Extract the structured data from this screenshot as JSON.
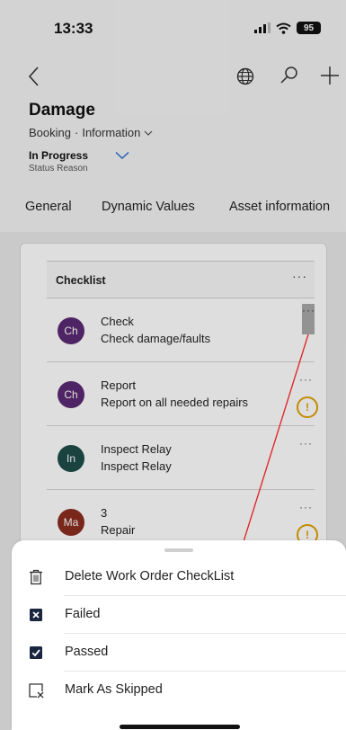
{
  "status_bar": {
    "time": "13:33",
    "battery": "95"
  },
  "record": {
    "title": "Damage",
    "entity": "Booking",
    "separator": "·",
    "form": "Information",
    "status_value": "In Progress",
    "status_label": "Status Reason"
  },
  "tabs": [
    {
      "label": "General"
    },
    {
      "label": "Dynamic Values"
    },
    {
      "label": "Asset information"
    }
  ],
  "checklist": {
    "title": "Checklist",
    "more": "···",
    "items": [
      {
        "initials": "Ch",
        "title": "Check",
        "subtitle": "Check damage/faults",
        "avatar_color": "#5b2a73",
        "warning": false
      },
      {
        "initials": "Ch",
        "title": "Report",
        "subtitle": "Report on all needed repairs",
        "avatar_color": "#5b2a73",
        "warning": true,
        "warning_glyph": "!"
      },
      {
        "initials": "In",
        "title": "Inspect Relay",
        "subtitle": "Inspect Relay",
        "avatar_color": "#1e4e4a",
        "warning": false
      },
      {
        "initials": "Ma",
        "title": "3",
        "subtitle": "Repair",
        "avatar_color": "#8c2d20",
        "warning": true,
        "warning_glyph": "!"
      }
    ]
  },
  "sheet": {
    "items": [
      {
        "label": "Delete Work Order CheckList",
        "icon": "trash-icon"
      },
      {
        "label": "Failed",
        "icon": "checkbox-failed-icon"
      },
      {
        "label": "Passed",
        "icon": "checkbox-passed-icon"
      },
      {
        "label": "Mark As Skipped",
        "icon": "mark-skipped-icon"
      }
    ]
  },
  "colors": {
    "annotation_arrow": "#e02020",
    "accent_blue": "#2b6cd6",
    "warning": "#e0a000"
  }
}
